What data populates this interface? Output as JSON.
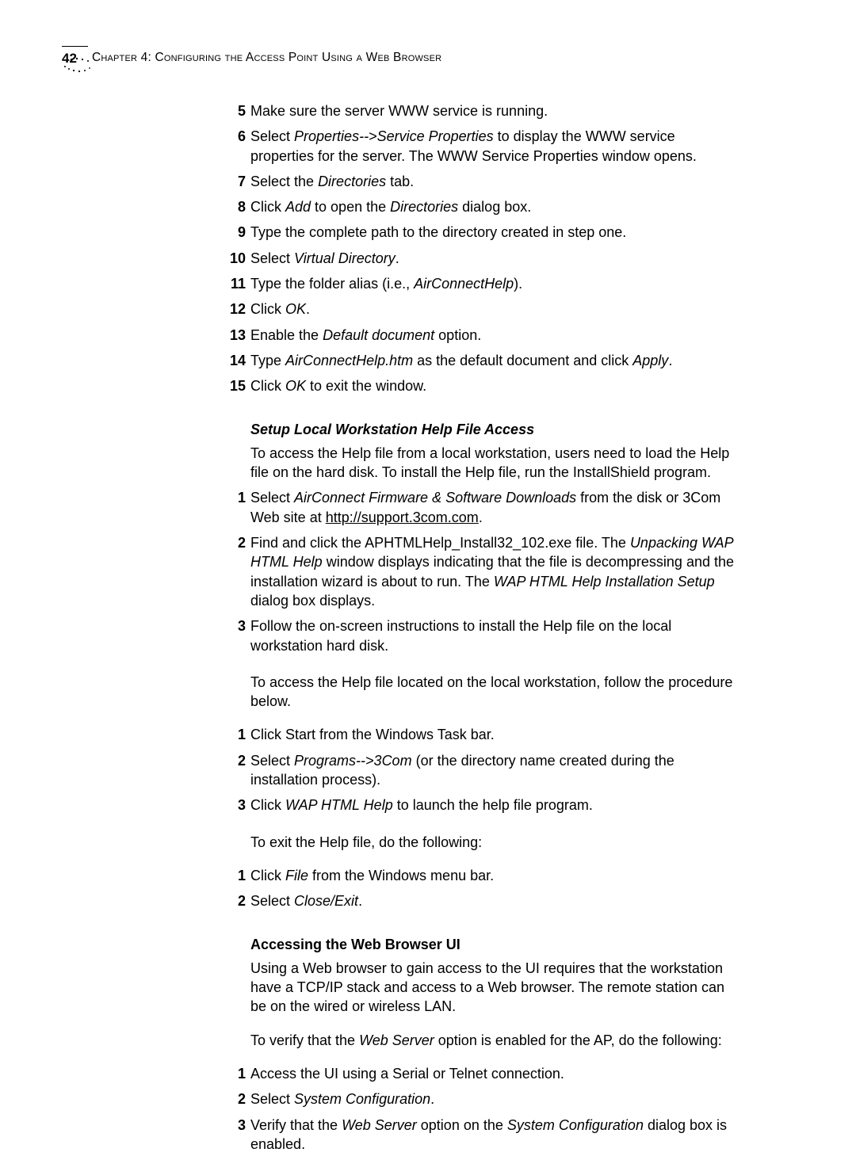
{
  "header": {
    "page_number": "42",
    "chapter": "Chapter 4: Configuring the Access Point Using a Web Browser"
  },
  "steps_a": [
    {
      "n": "5",
      "pre": "Make sure the server WWW service is running.",
      "ital": "",
      "post": ""
    },
    {
      "n": "6",
      "pre": "Select ",
      "ital": "Properties-->Service Properties",
      "post": " to display the WWW service properties for the server. The WWW Service Properties window opens."
    },
    {
      "n": "7",
      "pre": "Select the ",
      "ital": "Directories",
      "post": " tab."
    },
    {
      "n": "8",
      "pre": "Click ",
      "ital": "Add",
      "post": " to open the ",
      "ital2": "Directories",
      "post2": " dialog box."
    },
    {
      "n": "9",
      "pre": "Type the complete path to the directory created in step one.",
      "ital": "",
      "post": ""
    },
    {
      "n": "10",
      "pre": "Select ",
      "ital": "Virtual Directory",
      "post": "."
    },
    {
      "n": "11",
      "pre": "Type the folder alias (i.e., ",
      "ital": "AirConnectHelp",
      "post": ")."
    },
    {
      "n": "12",
      "pre": "Click ",
      "ital": "OK",
      "post": "."
    },
    {
      "n": "13",
      "pre": "Enable the ",
      "ital": "Default document",
      "post": " option."
    },
    {
      "n": "14",
      "pre": "Type ",
      "ital": "AirConnectHelp.htm",
      "post": " as the default document and click ",
      "ital2": "Apply",
      "post2": "."
    },
    {
      "n": "15",
      "pre": "Click ",
      "ital": "OK",
      "post": " to exit the window."
    }
  ],
  "section_b": {
    "title": "Setup Local Workstation Help File Access",
    "intro": "To access the Help file from a local workstation, users need to load the Help file on the hard disk. To install the Help file, run the InstallShield program.",
    "steps": [
      {
        "n": "1",
        "pre": "Select ",
        "ital": "AirConnect Firmware & Software Downloads",
        "post": " from the disk or 3Com Web site at ",
        "link": "http://support.3com.com",
        "post2": "."
      },
      {
        "n": "2",
        "pre": "Find and click the APHTMLHelp_Install32_102.exe file. The ",
        "ital": "Unpacking WAP HTML Help",
        "post": " window displays indicating that the file is decompressing and the installation wizard is about to run. The ",
        "ital2": "WAP HTML Help Installation Setup",
        "post2": " dialog box displays."
      },
      {
        "n": "3",
        "pre": "Follow the on-screen instructions to install the Help file on the local workstation hard disk.",
        "ital": "",
        "post": ""
      }
    ],
    "intro2": "To access the Help file located on the local workstation, follow the procedure below.",
    "steps2": [
      {
        "n": "1",
        "pre": "Click Start from the Windows Task bar.",
        "ital": "",
        "post": ""
      },
      {
        "n": "2",
        "pre": "Select ",
        "ital": "Programs-->3Com",
        "post": " (or the directory name created during the installation process)."
      },
      {
        "n": "3",
        "pre": "Click ",
        "ital": "WAP HTML Help",
        "post": " to launch the help file program."
      }
    ],
    "intro3": "To exit the Help file, do the following:",
    "steps3": [
      {
        "n": "1",
        "pre": "Click ",
        "ital": "File",
        "post": " from the Windows menu bar."
      },
      {
        "n": "2",
        "pre": "Select ",
        "ital": "Close/Exit",
        "post": "."
      }
    ]
  },
  "section_c": {
    "title": "Accessing the Web Browser UI",
    "intro": "Using a Web browser to gain access to the UI requires that the workstation have a TCP/IP stack and access to a Web browser. The remote station can be on the wired or wireless LAN.",
    "intro2_pre": "To verify that the ",
    "intro2_ital": "Web Server",
    "intro2_post": " option is enabled for the AP, do the following:",
    "steps": [
      {
        "n": "1",
        "pre": "Access the UI using a Serial or Telnet connection.",
        "ital": "",
        "post": ""
      },
      {
        "n": "2",
        "pre": "Select ",
        "ital": "System Configuration",
        "post": "."
      },
      {
        "n": "3",
        "pre": "Verify that the ",
        "ital": "Web Server",
        "post": " option on the ",
        "ital2": "System Configuration",
        "post2": " dialog box is enabled."
      }
    ]
  }
}
